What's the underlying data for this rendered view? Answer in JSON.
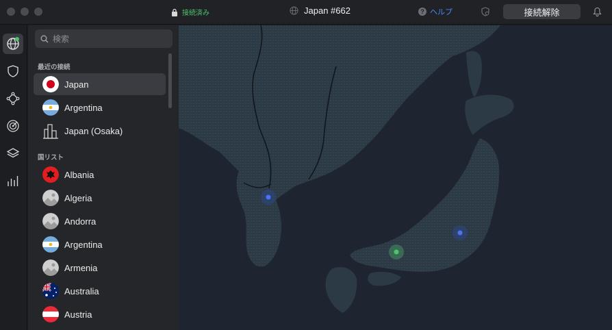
{
  "titlebar": {
    "status": "接続済み",
    "server": "Japan #662",
    "help": "ヘルプ",
    "disconnect": "接続解除"
  },
  "sidebar": {
    "search_placeholder": "検索",
    "recent_label": "最近の接続",
    "recent": [
      {
        "name": "Japan",
        "flag": "japan"
      },
      {
        "name": "Argentina",
        "flag": "argentina"
      },
      {
        "name": "Japan (Osaka)",
        "flag": "city-icon"
      }
    ],
    "countries_label": "国リスト",
    "countries": [
      {
        "name": "Albania",
        "flag": "albania"
      },
      {
        "name": "Algeria",
        "flag": "placeholder"
      },
      {
        "name": "Andorra",
        "flag": "placeholder"
      },
      {
        "name": "Argentina",
        "flag": "argentina"
      },
      {
        "name": "Armenia",
        "flag": "placeholder"
      },
      {
        "name": "Australia",
        "flag": "australia"
      },
      {
        "name": "Austria",
        "flag": "austria"
      }
    ]
  },
  "rail": [
    "globe-icon",
    "shield-icon",
    "meshnet-icon",
    "target-icon",
    "layers-icon",
    "stats-icon"
  ],
  "colors": {
    "connected": "#4fc36b",
    "accent": "#4e87f5",
    "land": "#2c3a45",
    "water": "#1e2430"
  }
}
